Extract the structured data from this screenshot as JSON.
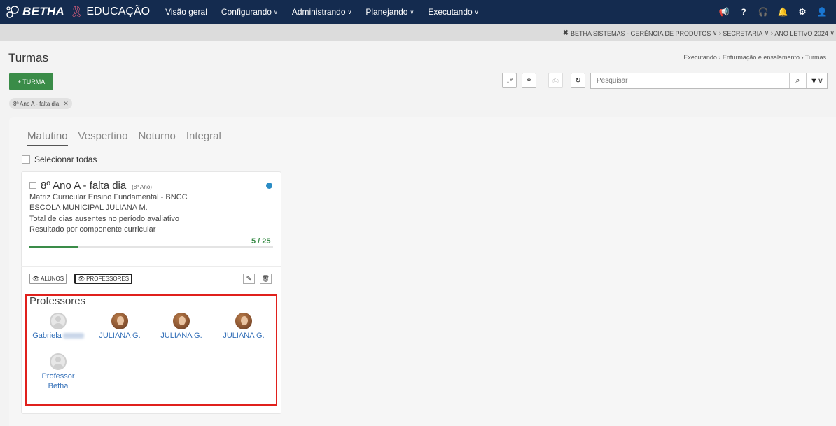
{
  "app": {
    "brand": "BETHA",
    "product": "EDUCAÇÃO"
  },
  "nav": {
    "items": [
      {
        "label": "Visão geral",
        "has_dropdown": false
      },
      {
        "label": "Configurando",
        "has_dropdown": true
      },
      {
        "label": "Administrando",
        "has_dropdown": true
      },
      {
        "label": "Planejando",
        "has_dropdown": true
      },
      {
        "label": "Executando",
        "has_dropdown": true
      }
    ],
    "right_icons": [
      "megaphone-icon",
      "help-icon",
      "headset-icon",
      "bell-icon",
      "settings-icon",
      "user-icon"
    ]
  },
  "context": {
    "entity": "BETHA SISTEMAS - GERÊNCIA DE PRODUTOS",
    "level": "SECRETARIA",
    "year": "ANO LETIVO 2024"
  },
  "page": {
    "title": "Turmas"
  },
  "breadcrumb": [
    "Executando",
    "Enturmação e ensalamento",
    "Turmas"
  ],
  "actions": {
    "add_label": "+ TURMA"
  },
  "search": {
    "placeholder": "Pesquisar"
  },
  "filter_chip": {
    "label": "8º Ano A - falta dia"
  },
  "tabs": [
    {
      "label": "Matutino",
      "active": true
    },
    {
      "label": "Vespertino",
      "active": false
    },
    {
      "label": "Noturno",
      "active": false
    },
    {
      "label": "Integral",
      "active": false
    }
  ],
  "select_all_label": "Selecionar todas",
  "card": {
    "name": "8º Ano A - falta dia",
    "grade": "(8º Ano)",
    "lines": [
      "Matriz Curricular Ensino Fundamental - BNCC",
      "ESCOLA MUNICIPAL JULIANA M.",
      "Total de dias ausentes no período avaliativo",
      "Resultado por componente curricular"
    ],
    "count": "5 / 25",
    "progress": 0.2,
    "status_color": "#2a8cc5",
    "view_buttons": [
      "ALUNOS",
      "PROFESSORES"
    ],
    "selected_view": "PROFESSORES"
  },
  "professores": {
    "title": "Professores",
    "items": [
      {
        "name": "Gabriela",
        "avatar": "generic"
      },
      {
        "name": "JULIANA G.",
        "avatar": "photo"
      },
      {
        "name": "JULIANA G.",
        "avatar": "photo"
      },
      {
        "name": "JULIANA G.",
        "avatar": "photo"
      },
      {
        "name": "Professor Betha",
        "avatar": "generic"
      }
    ]
  },
  "colors": {
    "nav_bg": "#142b4f",
    "primary_green": "#3a8c48",
    "link_blue": "#3470b8",
    "highlight_red": "#e0201c"
  }
}
